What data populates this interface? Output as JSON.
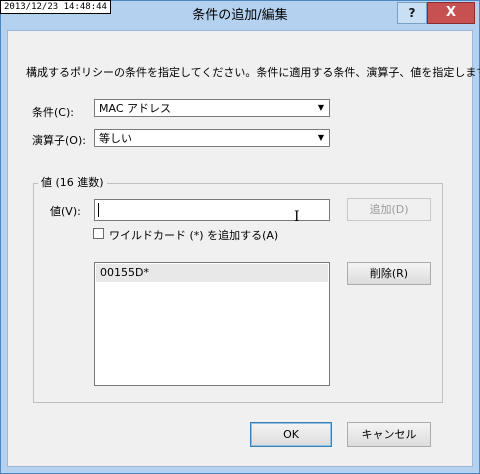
{
  "window": {
    "timestamp": "2013/12/23 14:48:44",
    "title": "条件の追加/編集",
    "help_label": "?",
    "close_label": "X"
  },
  "description": "構成するポリシーの条件を指定してください。条件に適用する条件、演算子、値を指定します。",
  "condition": {
    "label": "条件(C):",
    "value": "MAC アドレス"
  },
  "operator": {
    "label": "演算子(O):",
    "value": "等しい"
  },
  "value_group": {
    "title": "値 (16 進数)",
    "value_label": "値(V):",
    "value_input": "",
    "add_button": "追加(D)",
    "wildcard_label": "ワイルドカード (*) を追加する(A)",
    "list_items": [
      "00155D*"
    ],
    "delete_button": "削除(R)"
  },
  "footer": {
    "ok_button": "OK",
    "cancel_button": "キャンセル"
  }
}
